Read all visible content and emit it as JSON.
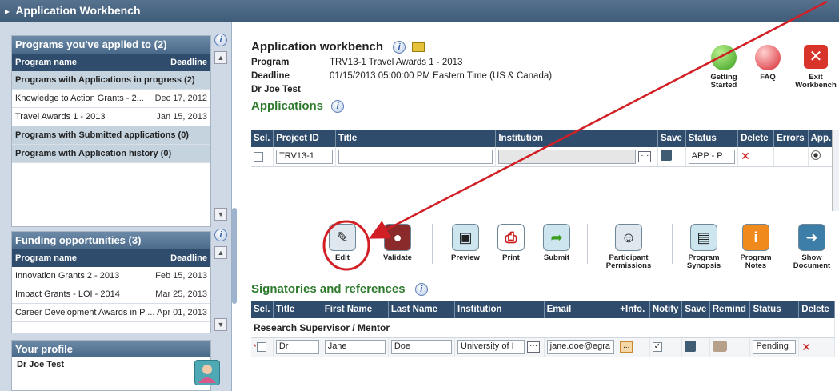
{
  "window": {
    "title": "Application Workbench"
  },
  "sidebar": {
    "programs": {
      "title": "Programs you've applied to (2)",
      "col_name": "Program name",
      "col_deadline": "Deadline",
      "rows": [
        {
          "type": "group",
          "name": "Programs with Applications in progress (2)"
        },
        {
          "type": "item",
          "name": "Knowledge to Action Grants - 2...",
          "date": "Dec 17, 2012"
        },
        {
          "type": "item",
          "name": "Travel Awards 1 - 2013",
          "date": "Jan 15, 2013"
        },
        {
          "type": "group",
          "name": "Programs with Submitted applications (0)"
        },
        {
          "type": "group",
          "name": "Programs with Application history (0)"
        }
      ]
    },
    "funding": {
      "title": "Funding opportunities (3)",
      "col_name": "Program name",
      "col_deadline": "Deadline",
      "rows": [
        {
          "name": "Innovation Grants 2 - 2013",
          "date": "Feb 15, 2013"
        },
        {
          "name": "Impact Grants - LOI - 2014",
          "date": "Mar 25, 2013"
        },
        {
          "name": "Career Development Awards in P ...",
          "date": "Apr 01, 2013"
        }
      ]
    },
    "profile": {
      "title": "Your profile",
      "name": "Dr Joe Test"
    }
  },
  "main": {
    "heading": "Application workbench",
    "program_label": "Program",
    "program_value": "TRV13-1  Travel Awards 1 - 2013",
    "deadline_label": "Deadline",
    "deadline_value": "01/15/2013 05:00:00 PM Eastern Time (US & Canada)",
    "user": "Dr Joe Test",
    "top_actions": [
      {
        "label": "Getting Started",
        "icon": "green-circle-icon"
      },
      {
        "label": "FAQ",
        "icon": "magnifier-icon"
      },
      {
        "label": "Exit Workbench",
        "icon": "close-icon"
      }
    ],
    "applications": {
      "title": "Applications",
      "columns": [
        "Sel.",
        "Project ID",
        "Title",
        "Institution",
        "Save",
        "Status",
        "Delete",
        "Errors",
        "App."
      ],
      "row": {
        "project_id": "TRV13-1",
        "title": "",
        "institution": "",
        "status": "APP - P"
      }
    },
    "toolbar": [
      {
        "label": "Edit",
        "icon": "pencil-icon"
      },
      {
        "label": "Validate",
        "icon": "seal-icon"
      },
      {
        "label": "Preview",
        "icon": "preview-icon"
      },
      {
        "label": "Print",
        "icon": "pdf-icon"
      },
      {
        "label": "Submit",
        "icon": "arrow-icon"
      },
      {
        "label": "Participant Permissions",
        "icon": "people-icon"
      },
      {
        "label": "Program Synopsis",
        "icon": "document-icon"
      },
      {
        "label": "Program Notes",
        "icon": "info-icon"
      },
      {
        "label": "Show Document",
        "icon": "arrow-right-icon"
      }
    ],
    "signatories": {
      "title": "Signatories and references",
      "columns": [
        "Sel.",
        "Title",
        "First Name",
        "Last Name",
        "Institution",
        "Email",
        "+Info.",
        "Notify",
        "Save",
        "Remind",
        "Status",
        "Delete"
      ],
      "group": "Research Supervisor / Mentor",
      "row": {
        "title": "Dr",
        "first_name": "Jane",
        "last_name": "Doe",
        "institution": "University of I",
        "email": "jane.doe@egra",
        "info": "...",
        "status": "Pending"
      }
    }
  },
  "colors": {
    "accent_green": "#2d7a2d",
    "header_navy": "#2f4c6c",
    "annotation_red": "#d21f26"
  }
}
